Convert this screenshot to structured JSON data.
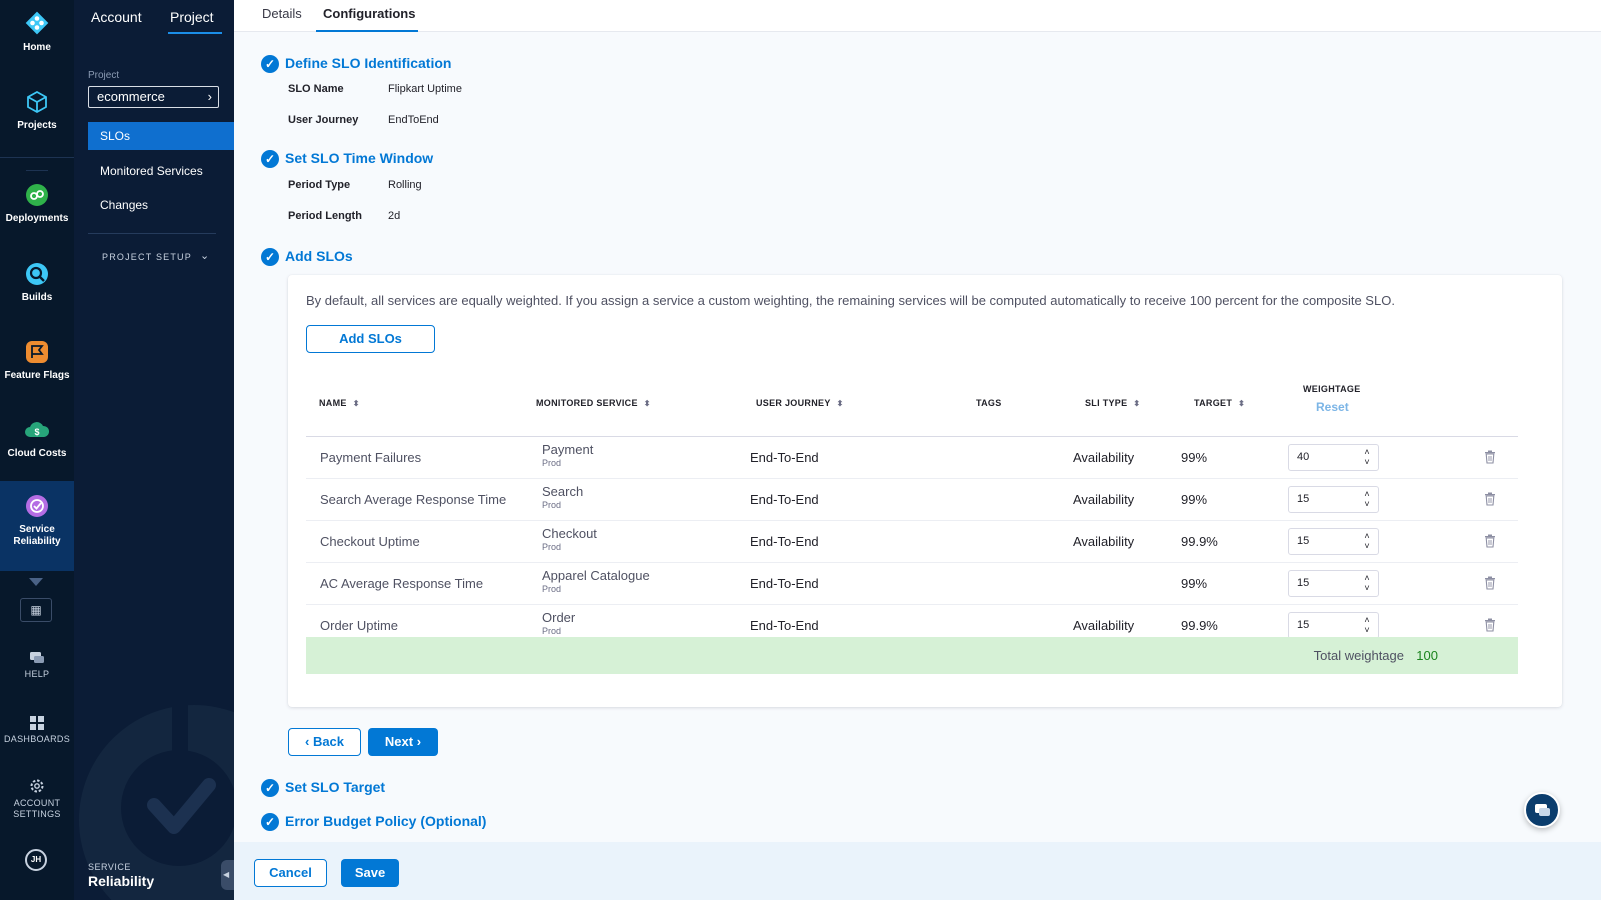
{
  "rail": {
    "items": [
      {
        "label": "Home",
        "icon": "harness-logo-icon"
      },
      {
        "label": "Projects",
        "icon": "cube-icon"
      },
      {
        "label": "Deployments",
        "icon": "deployments-icon"
      },
      {
        "label": "Builds",
        "icon": "builds-icon"
      },
      {
        "label": "Feature Flags",
        "icon": "feature-flags-icon"
      },
      {
        "label": "Cloud Costs",
        "icon": "cloud-costs-icon"
      },
      {
        "label": "Service Reliability",
        "icon": "service-reliability-icon"
      }
    ],
    "help": "HELP",
    "dashboards": "DASHBOARDS",
    "account_settings": "ACCOUNT SETTINGS",
    "avatar": "JH"
  },
  "nav": {
    "tabs": [
      "Account",
      "Project"
    ],
    "project_label": "Project",
    "project_value": "ecommerce",
    "items": [
      "SLOs",
      "Monitored Services",
      "Changes"
    ],
    "project_setup": "PROJECT SETUP",
    "footer_small": "SERVICE",
    "footer_big": "Reliability"
  },
  "tabs": [
    "Details",
    "Configurations"
  ],
  "steps": {
    "identification": {
      "title": "Define SLO Identification",
      "fields": [
        {
          "label": "SLO Name",
          "value": "Flipkart Uptime"
        },
        {
          "label": "User Journey",
          "value": "EndToEnd"
        }
      ]
    },
    "time_window": {
      "title": "Set SLO Time Window",
      "fields": [
        {
          "label": "Period Type",
          "value": "Rolling"
        },
        {
          "label": "Period Length",
          "value": "2d"
        }
      ]
    },
    "add_slos": {
      "title": "Add SLOs",
      "info": "By default, all services are equally weighted. If you assign a service a custom weighting, the remaining services will be computed automatically to receive 100 percent for the composite SLO.",
      "add_button": "Add SLOs",
      "columns": {
        "name": "NAME",
        "monitored_service": "MONITORED SERVICE",
        "user_journey": "USER JOURNEY",
        "tags": "TAGS",
        "sli_type": "SLI TYPE",
        "target": "TARGET",
        "weightage": "WEIGHTAGE",
        "reset": "Reset"
      },
      "rows": [
        {
          "name": "Payment Failures",
          "service": "Payment",
          "env": "Prod",
          "journey": "End-To-End",
          "sli": "Availability",
          "target": "99%",
          "weight": "40"
        },
        {
          "name": "Search Average Response Time",
          "service": "Search",
          "env": "Prod",
          "journey": "End-To-End",
          "sli": "Availability",
          "target": "99%",
          "weight": "15"
        },
        {
          "name": "Checkout Uptime",
          "service": "Checkout",
          "env": "Prod",
          "journey": "End-To-End",
          "sli": "Availability",
          "target": "99.9%",
          "weight": "15"
        },
        {
          "name": "AC Average Response Time",
          "service": "Apparel Catalogue",
          "env": "Prod",
          "journey": "End-To-End",
          "sli": "",
          "target": "99%",
          "weight": "15"
        },
        {
          "name": "Order Uptime",
          "service": "Order",
          "env": "Prod",
          "journey": "End-To-End",
          "sli": "Availability",
          "target": "99.9%",
          "weight": "15"
        }
      ],
      "total_label": "Total weightage",
      "total_value": "100"
    },
    "target": {
      "title": "Set SLO Target"
    },
    "error_budget": {
      "title": "Error Budget Policy (Optional)"
    }
  },
  "buttons": {
    "back": "Back",
    "next": "Next",
    "cancel": "Cancel",
    "save": "Save"
  },
  "colors": {
    "primary": "#0278d5",
    "rail_bg": "#07182b",
    "nav_bg": "#0b1c36",
    "total_bg": "#d6f1d6"
  }
}
